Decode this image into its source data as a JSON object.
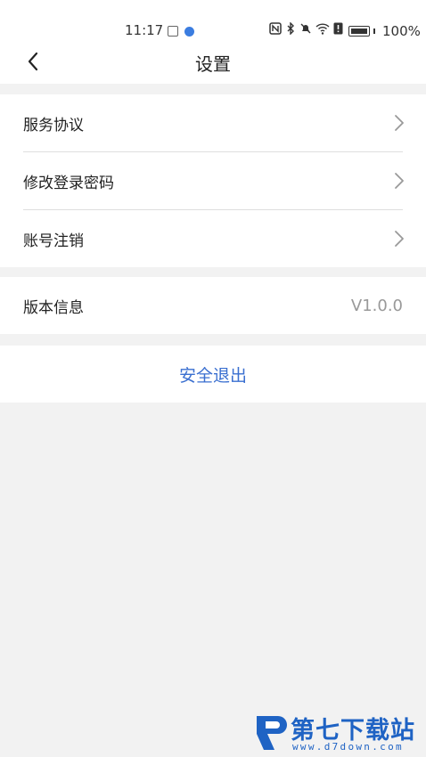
{
  "status_bar": {
    "time": "11:17",
    "battery": "100%",
    "icons": [
      "nfc-icon",
      "bluetooth-icon",
      "mute-icon",
      "wifi-icon",
      "sim-alert-icon",
      "battery-icon"
    ]
  },
  "header": {
    "title": "设置",
    "back_icon": "chevron-left-icon"
  },
  "settings": {
    "items": [
      {
        "label": "服务协议",
        "icon": "chevron-right-icon"
      },
      {
        "label": "修改登录密码",
        "icon": "chevron-right-icon"
      },
      {
        "label": "账号注销",
        "icon": "chevron-right-icon"
      }
    ],
    "version": {
      "label": "版本信息",
      "value": "V1.0.0"
    },
    "logout_label": "安全退出"
  },
  "watermark": {
    "brand": "第七下载站",
    "url": "www.d7down.com"
  },
  "colors": {
    "accent": "#3a6fd0",
    "background": "#f2f2f2",
    "muted_text": "#999999",
    "watermark": "#1f63c4"
  }
}
